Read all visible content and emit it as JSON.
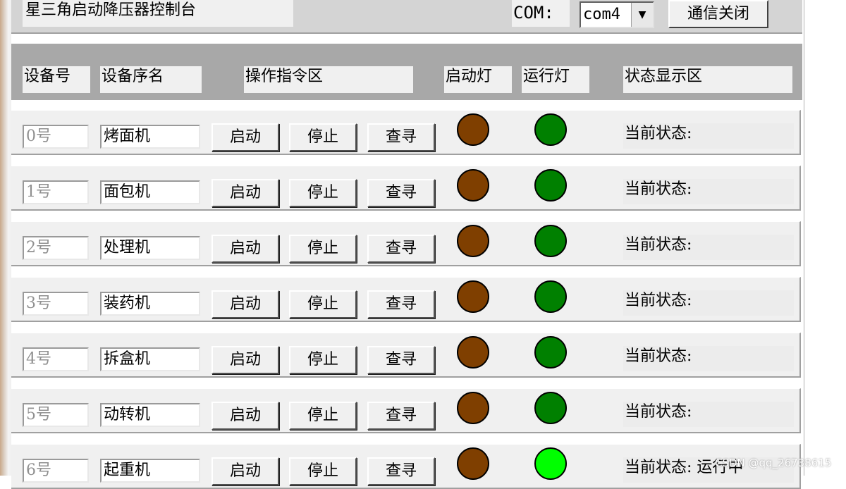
{
  "window": {
    "title": "星三角启动降压器控制台"
  },
  "toolbar": {
    "com_label": "COM:",
    "com_value": "com4",
    "close_label": "通信关闭"
  },
  "headers": {
    "device_no": "设备号",
    "device_name": "设备序名",
    "command_area": "操作指令区",
    "start_lamp": "启动灯",
    "run_lamp": "运行灯",
    "status_area": "状态显示区"
  },
  "buttons": {
    "start": "启动",
    "stop": "停止",
    "query": "查寻"
  },
  "colors": {
    "start_lamp": "#7f3f00",
    "run_lamp_off": "#008000",
    "run_lamp_on": "#00ff00"
  },
  "devices": [
    {
      "no": "0号",
      "name": "烤面机",
      "status": "当前状态:",
      "running": false
    },
    {
      "no": "1号",
      "name": "面包机",
      "status": "当前状态:",
      "running": false
    },
    {
      "no": "2号",
      "name": "处理机",
      "status": "当前状态:",
      "running": false
    },
    {
      "no": "3号",
      "name": "装药机",
      "status": "当前状态:",
      "running": false
    },
    {
      "no": "4号",
      "name": "拆盒机",
      "status": "当前状态:",
      "running": false
    },
    {
      "no": "5号",
      "name": "动转机",
      "status": "当前状态:",
      "running": false
    },
    {
      "no": "6号",
      "name": "起重机",
      "status": "当前状态: 运行中",
      "running": true
    }
  ],
  "watermark": "CSDN @qq_26738615"
}
